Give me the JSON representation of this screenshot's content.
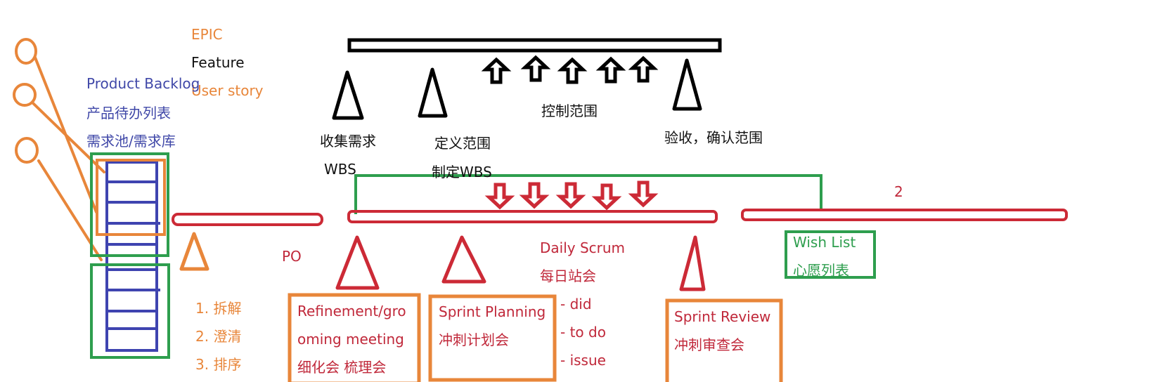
{
  "colors": {
    "orange": "#e8863a",
    "black": "#111111",
    "blue": "#3f44b0",
    "red": "#cc2a36",
    "green": "#2e9e4e"
  },
  "hierarchy": {
    "epic": "EPIC",
    "feature": "Feature",
    "user_story": "User story"
  },
  "backlog": {
    "title_en": "Product Backlog",
    "title_cn": "产品待办列表",
    "alias": "需求池/需求库"
  },
  "po_label": "PO",
  "refinement_steps": [
    "1. 拆解",
    "2. 澄清",
    "3. 排序"
  ],
  "scope_flow": {
    "collect": "收集需求",
    "collect_sub": "WBS",
    "define": "定义范围",
    "define_sub": "制定WBS",
    "control": "控制范围",
    "validate": "验收，确认范围"
  },
  "sprint_number": "2",
  "events": {
    "refinement": [
      "Refinement/gro",
      "oming meeting",
      "细化会 梳理会"
    ],
    "planning": [
      "Sprint Planning",
      "冲刺计划会"
    ],
    "daily": {
      "title_en": "Daily Scrum",
      "title_cn": "每日站会",
      "items": [
        "- did",
        "- to do",
        "- issue"
      ]
    },
    "review": [
      "Sprint Review",
      "冲刺审查会"
    ]
  },
  "wish_list": {
    "title_en": "Wish List",
    "title_cn": "心愿列表"
  }
}
